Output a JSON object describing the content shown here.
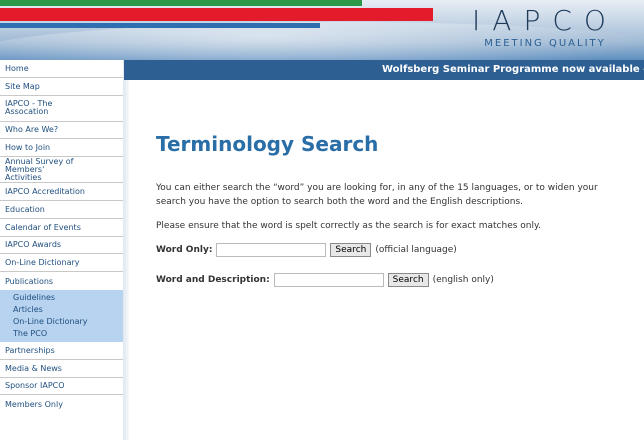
{
  "header": {
    "logo_name": "IAPCO",
    "logo_tagline": "MEETING QUALITY"
  },
  "ticker": {
    "text": "Wolfsberg Seminar Programme now available - see new Edu"
  },
  "sidebar": {
    "items": [
      {
        "label": "Home"
      },
      {
        "label": "Site Map"
      },
      {
        "label": "IAPCO - The Assocation"
      },
      {
        "label": "Who Are We?"
      },
      {
        "label": "How to Join"
      },
      {
        "label": "Annual Survey of Members' Activities"
      },
      {
        "label": "IAPCO Accreditation"
      },
      {
        "label": "Education"
      },
      {
        "label": "Calendar of Events"
      },
      {
        "label": "IAPCO Awards"
      },
      {
        "label": "On-Line Dictionary"
      },
      {
        "label": "Publications"
      }
    ],
    "sub_items": [
      {
        "label": "Guidelines"
      },
      {
        "label": "Articles"
      },
      {
        "label": "On-Line Dictionary"
      },
      {
        "label": "The PCO"
      }
    ],
    "items_after": [
      {
        "label": "Partnerships"
      },
      {
        "label": "Media & News"
      },
      {
        "label": "Sponsor IAPCO"
      },
      {
        "label": "Members Only"
      }
    ]
  },
  "main": {
    "title": "Terminology Search",
    "intro": "You can either search the “word” you are looking for, in any of the 15 languages, or to widen your search you have the option to search both the word and the English descriptions.",
    "note": "Please ensure that the word is spelt correctly as the search is for exact matches only.",
    "word_only": {
      "label": "Word Only:",
      "value": "",
      "button": "Search",
      "hint": "(official language)"
    },
    "word_desc": {
      "label": "Word and Description:",
      "value": "",
      "button": "Search",
      "hint": "(english only)"
    }
  },
  "colors": {
    "brand_blue": "#2e5f93",
    "title_blue": "#2a6ea8",
    "stripe_green": "#2d9a4a",
    "stripe_red": "#e41b2b",
    "submenu_bg": "#b7d3ef"
  }
}
